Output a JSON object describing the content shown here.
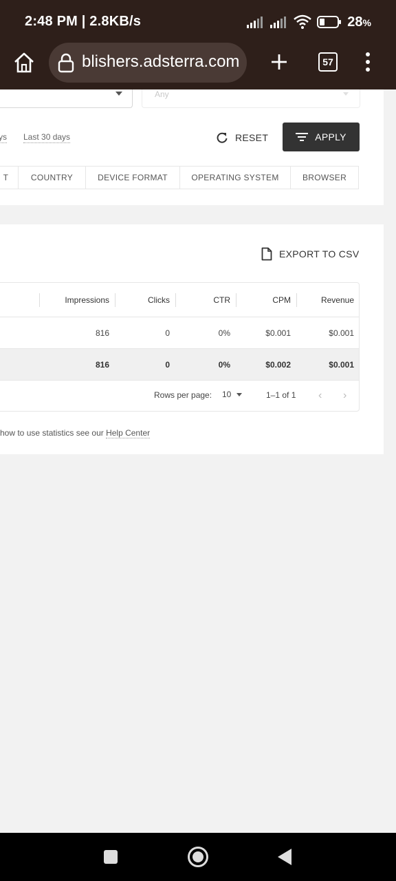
{
  "status_bar": {
    "time": "2:48 PM | 2.8KB/s",
    "battery": "28",
    "battery_unit": "%"
  },
  "browser": {
    "url": "blishers.adsterra.com",
    "tab_count": "57"
  },
  "filters": {
    "right_select_placeholder": "Any",
    "date_links": [
      "ys",
      "Last 30 days"
    ],
    "reset_label": "RESET",
    "apply_label": "APPLY",
    "tabs": [
      "T",
      "COUNTRY",
      "DEVICE FORMAT",
      "OPERATING SYSTEM",
      "BROWSER"
    ]
  },
  "stats": {
    "export_label": "EXPORT TO CSV",
    "columns": [
      "Impressions",
      "Clicks",
      "CTR",
      "CPM",
      "Revenue"
    ],
    "rows": [
      [
        "816",
        "0",
        "0%",
        "$0.001",
        "$0.001"
      ]
    ],
    "total": [
      "816",
      "0",
      "0%",
      "$0.002",
      "$0.001"
    ],
    "pagination": {
      "rows_per_page_label": "Rows per page:",
      "rows_per_page_value": "10",
      "range": "1–1 of 1",
      "prev": "‹",
      "next": "›"
    },
    "help_prefix": "how to use statistics see our ",
    "help_link": "Help Center"
  },
  "colors": {
    "browser_chrome": "#2e1f1a",
    "url_pill": "#4a3a35",
    "apply_button": "#333333",
    "page_background": "#f2f2f2"
  }
}
